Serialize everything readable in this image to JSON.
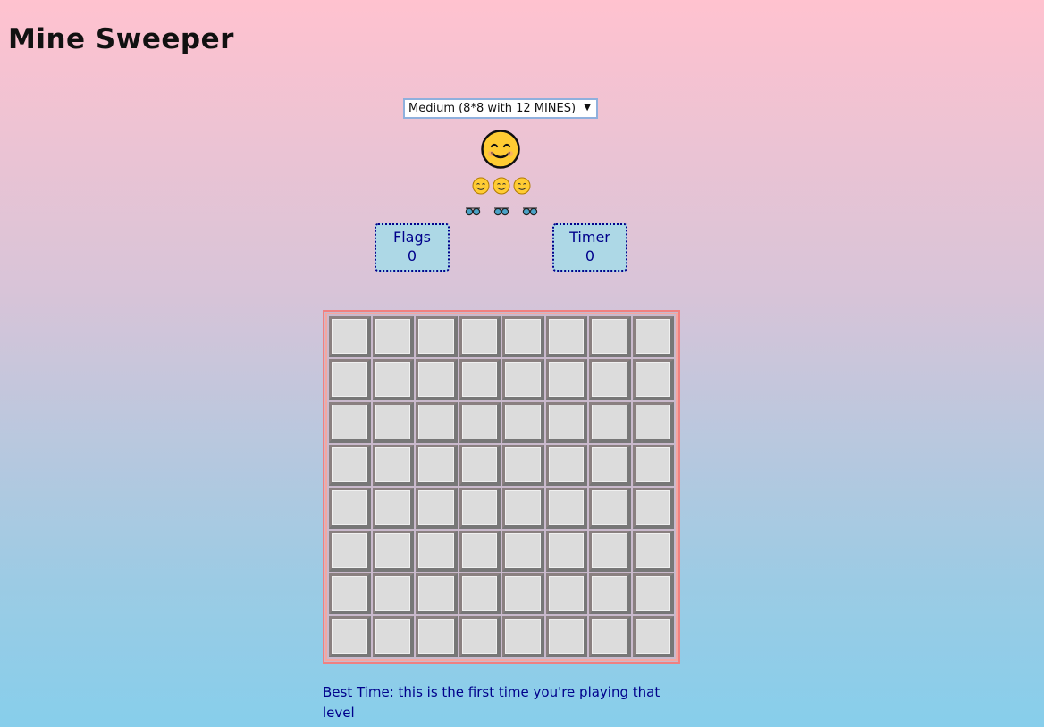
{
  "title": "Mine Sweeper",
  "level_select": {
    "selected": "Medium (8*8 with 12 MINES)"
  },
  "status": {
    "smiley_icon": "smiling-face-icon",
    "lives": [
      "smiling-face-icon",
      "smiling-face-icon",
      "smiling-face-icon"
    ],
    "hints": [
      "sunglasses-icon",
      "sunglasses-icon",
      "sunglasses-icon"
    ]
  },
  "flags": {
    "label": "Flags",
    "value": "0"
  },
  "timer": {
    "label": "Timer",
    "value": "0"
  },
  "board": {
    "rows": 8,
    "cols": 8,
    "cell_state": "covered"
  },
  "best_time": "Best Time: this is the first time you're playing that level",
  "colors": {
    "counter_bg": "#add8e6",
    "counter_text": "#00008b",
    "board_border": "#f08080",
    "cell": "#dcdcdc"
  }
}
